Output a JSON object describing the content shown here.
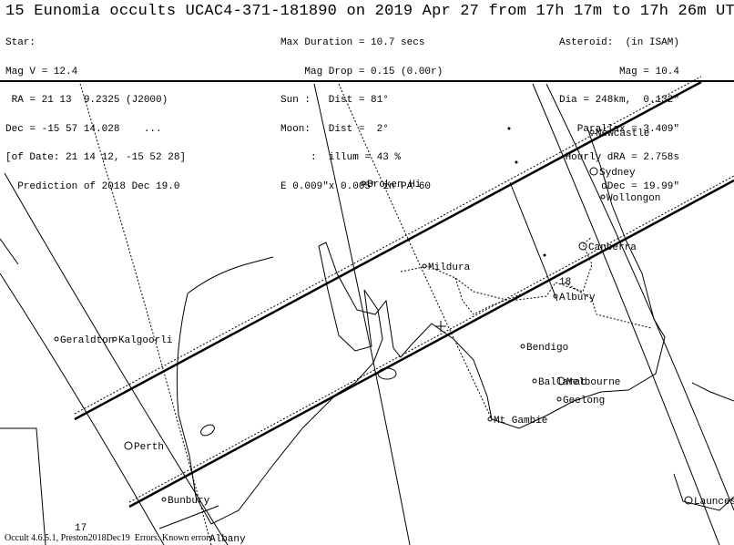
{
  "title": "15 Eunomia occults UCAC4-371-181890 on 2019 Apr 27 from 17h 17m to 17h 26m UT",
  "star": {
    "heading": "Star:",
    "mag": "Mag V = 12.4",
    "ra": " RA = 21 13  9.2325 (J2000)",
    "dec": "Dec = -15 57 14.028    ...",
    "of_date": "[of Date: 21 14 12, -15 52 28]",
    "prediction": "  Prediction of 2018 Dec 19.0"
  },
  "event": {
    "max_duration": "Max Duration = 10.7 secs",
    "mag_drop": "    Mag Drop = 0.15 (0.00r)",
    "sun": "Sun :   Dist = 81°",
    "moon": "Moon:   Dist =  2°",
    "illum": "     :  illum = 43 %",
    "error_ellipse": "E 0.009\"x 0.005\" in PA 60"
  },
  "asteroid": {
    "heading": "Asteroid:  (in ISAM)",
    "mag": "Mag = 10.4",
    "dia": "Dia = 248km,  0.132\"",
    "parallax": "Parallax = 3.409\"",
    "hourly_dra": "Hourly dRA = 2.758s",
    "ddec": "dDec = 19.99\""
  },
  "map": {
    "cities": [
      "Newcastle",
      "Sydney",
      "Wollongon",
      "Broken Hi",
      "Canberra",
      "Mildura",
      "Albury",
      "Geraldton",
      "Kalgoorli",
      "Bendigo",
      "Ballarat",
      "Melbourne",
      "Geelong",
      "Mt Gambie",
      "Perth",
      "Bunbury",
      "Albany",
      "Launces"
    ],
    "time_labels": [
      "18",
      "17"
    ]
  },
  "footer": "Occult 4.6.5.1, Preston2018Dec19  Errors: Known errors"
}
